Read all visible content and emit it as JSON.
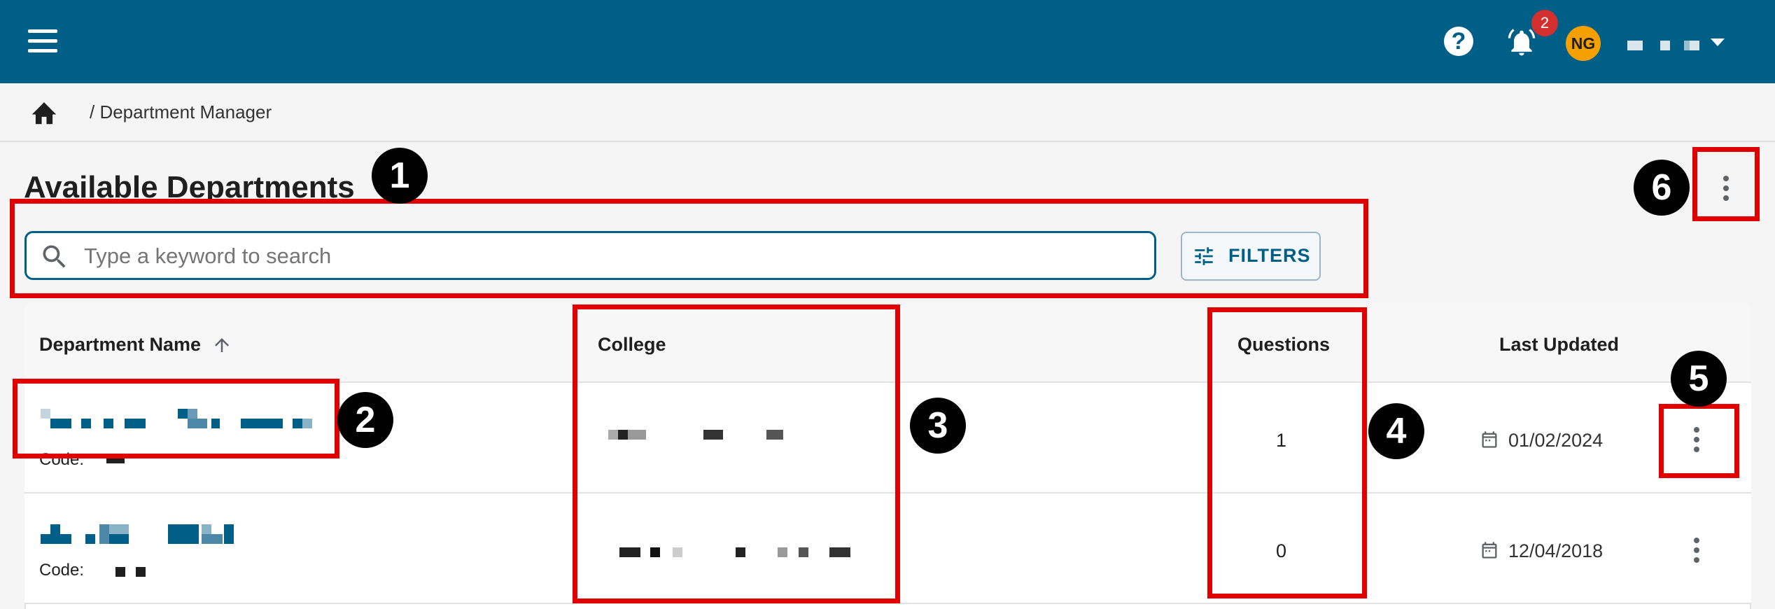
{
  "header": {
    "menu_icon": "hamburger-icon",
    "help_icon": "?",
    "notifications_count": "2",
    "avatar_initials": "NG"
  },
  "breadcrumb": {
    "home_icon": "home-icon",
    "current": "/ Department Manager"
  },
  "page": {
    "title": "Available Departments",
    "menu_icon": "more-vert-icon"
  },
  "search": {
    "placeholder": "Type a keyword to search"
  },
  "filters": {
    "label": "FILTERS",
    "icon": "tune-icon"
  },
  "table": {
    "columns": [
      "Department Name",
      "College",
      "Questions",
      "Last Updated"
    ],
    "sort_icon": "arrow-up-icon",
    "rows": [
      {
        "code_label": "Code:",
        "questions": "1",
        "last_updated": "01/02/2024"
      },
      {
        "code_label": "Code:",
        "questions": "0",
        "last_updated": "12/04/2018"
      }
    ]
  },
  "annotations": [
    "1",
    "2",
    "3",
    "4",
    "5",
    "6"
  ],
  "colors": {
    "header": "#005f87",
    "highlight": "#e00000",
    "badge": "#d32f2f",
    "avatar": "#f5a000"
  }
}
